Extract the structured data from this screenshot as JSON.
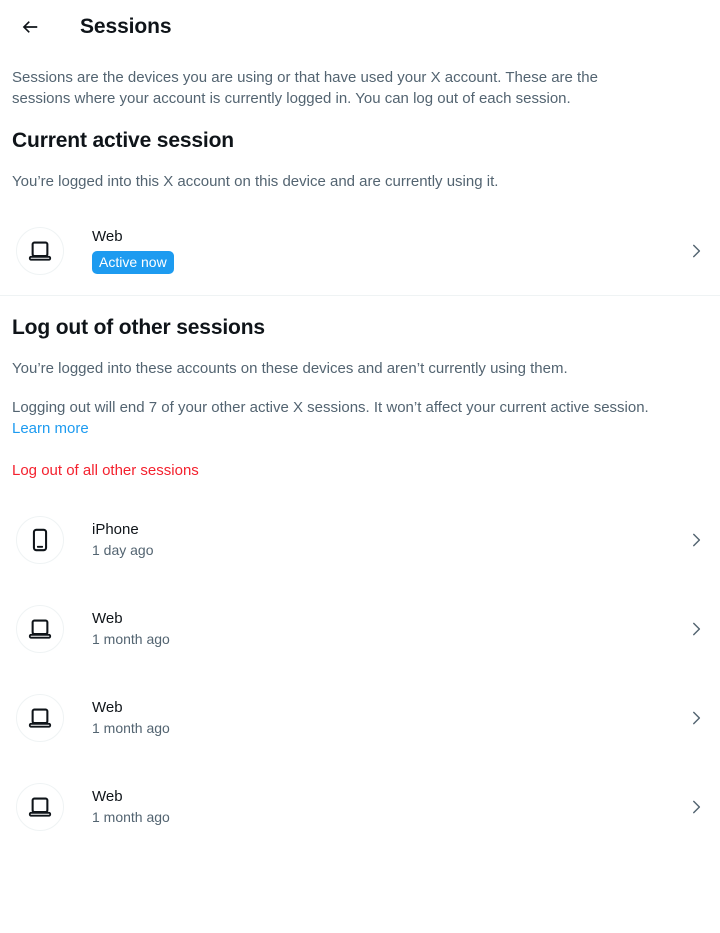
{
  "header": {
    "back_icon": "arrow-left-icon",
    "title": "Sessions"
  },
  "intro": "Sessions are the devices you are using or that have used your X account. These are the sessions where your account is currently logged in. You can log out of each session.",
  "current_section": {
    "title": "Current active session",
    "description": "You’re logged into this X account on this device and are currently using it.",
    "session": {
      "icon": "laptop-icon",
      "name": "Web",
      "badge": "Active now",
      "chevron": "chevron-right-icon"
    }
  },
  "other_section": {
    "title": "Log out of other sessions",
    "description": "You’re logged into these accounts on these devices and aren’t currently using them.",
    "warning_text": "Logging out will end 7 of your other active X sessions. It won’t affect your current active session. ",
    "learn_more": "Learn more",
    "logout_all_label": "Log out of all other sessions",
    "sessions": [
      {
        "icon": "phone-icon",
        "name": "iPhone",
        "last_active": "1 day ago",
        "chevron": "chevron-right-icon"
      },
      {
        "icon": "laptop-icon",
        "name": "Web",
        "last_active": "1 month ago",
        "chevron": "chevron-right-icon"
      },
      {
        "icon": "laptop-icon",
        "name": "Web",
        "last_active": "1 month ago",
        "chevron": "chevron-right-icon"
      },
      {
        "icon": "laptop-icon",
        "name": "Web",
        "last_active": "1 month ago",
        "chevron": "chevron-right-icon"
      }
    ]
  },
  "colors": {
    "accent_blue": "#1d9bf0",
    "danger_red": "#f4212e",
    "text_primary": "#0f1419",
    "text_secondary": "#536471",
    "divider": "#eff3f4"
  }
}
